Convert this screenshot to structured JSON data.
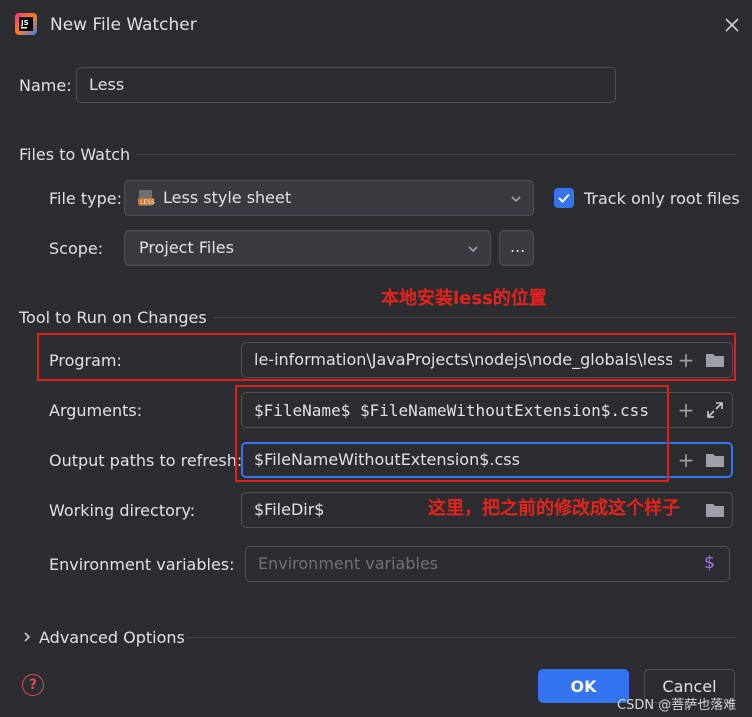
{
  "window": {
    "title": "New File Watcher"
  },
  "name_field": {
    "label": "Name:",
    "value": "Less"
  },
  "files_to_watch": {
    "section_title": "Files to Watch",
    "file_type_label": "File type:",
    "file_type_value": "Less style sheet",
    "track_root_label": "Track only root files",
    "track_root_checked": true,
    "scope_label": "Scope:",
    "scope_value": "Project Files",
    "scope_more": "..."
  },
  "tool": {
    "section_title": "Tool to Run on Changes",
    "program_label": "Program:",
    "program_value": "le-information\\JavaProjects\\nodejs\\node_globals\\lessc",
    "arguments_label": "Arguments:",
    "arguments_value": "$FileName$ $FileNameWithoutExtension$.css",
    "output_label": "Output paths to refresh:",
    "output_value": "$FileNameWithoutExtension$.css",
    "workdir_label": "Working directory:",
    "workdir_value": "$FileDir$",
    "env_label": "Environment variables:",
    "env_placeholder": "Environment variables"
  },
  "advanced": {
    "label": "Advanced Options"
  },
  "footer": {
    "ok": "OK",
    "cancel": "Cancel",
    "help": "?"
  },
  "annotations": {
    "top": "本地安装less的位置",
    "bottom": "这里，把之前的修改成这个样子"
  },
  "watermark": "CSDN @菩萨也落难",
  "colors": {
    "accent": "#3574f0",
    "annotation": "#e0211b",
    "background": "#2b2d30"
  }
}
